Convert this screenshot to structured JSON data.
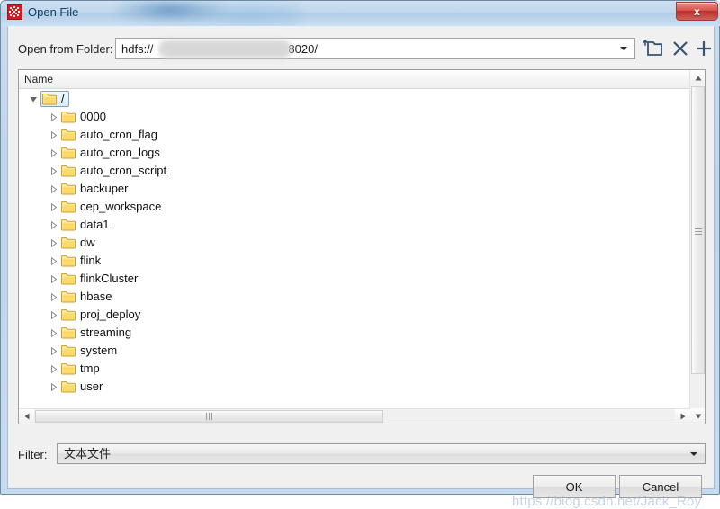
{
  "window": {
    "title": "Open File",
    "icon": "app-red-glyph-icon",
    "close_label": "x",
    "accent_close": "#bc2f2a",
    "accent_titlebar": "#bfd6ec"
  },
  "path_row": {
    "label": "Open from Folder:",
    "value": "hdfs://",
    "value_suffix": "8020/",
    "redacted": true,
    "dropdown_icon": "chevron-down-icon",
    "tools": [
      {
        "name": "folder-up-icon",
        "title": "Up one folder"
      },
      {
        "name": "delete-x-icon",
        "title": "Delete folder"
      },
      {
        "name": "new-plus-icon",
        "title": "New folder"
      }
    ]
  },
  "tree": {
    "header": "Name",
    "root": {
      "label": "/",
      "expanded": true,
      "selected": true
    },
    "items": [
      {
        "label": "0000",
        "expanded": false
      },
      {
        "label": "auto_cron_flag",
        "expanded": false
      },
      {
        "label": "auto_cron_logs",
        "expanded": false
      },
      {
        "label": "auto_cron_script",
        "expanded": false
      },
      {
        "label": "backuper",
        "expanded": false
      },
      {
        "label": "cep_workspace",
        "expanded": false
      },
      {
        "label": "data1",
        "expanded": false
      },
      {
        "label": "dw",
        "expanded": false
      },
      {
        "label": "flink",
        "expanded": false
      },
      {
        "label": "flinkCluster",
        "expanded": false
      },
      {
        "label": "hbase",
        "expanded": false
      },
      {
        "label": "proj_deploy",
        "expanded": false
      },
      {
        "label": "streaming",
        "expanded": false
      },
      {
        "label": "system",
        "expanded": false
      },
      {
        "label": "tmp",
        "expanded": false
      },
      {
        "label": "user",
        "expanded": false
      }
    ]
  },
  "filter_row": {
    "label": "Filter:",
    "value": "文本文件",
    "dropdown_icon": "chevron-down-icon"
  },
  "buttons": {
    "ok": "OK",
    "cancel": "Cancel"
  },
  "watermark": "https://blog.csdn.net/Jack_Roy"
}
